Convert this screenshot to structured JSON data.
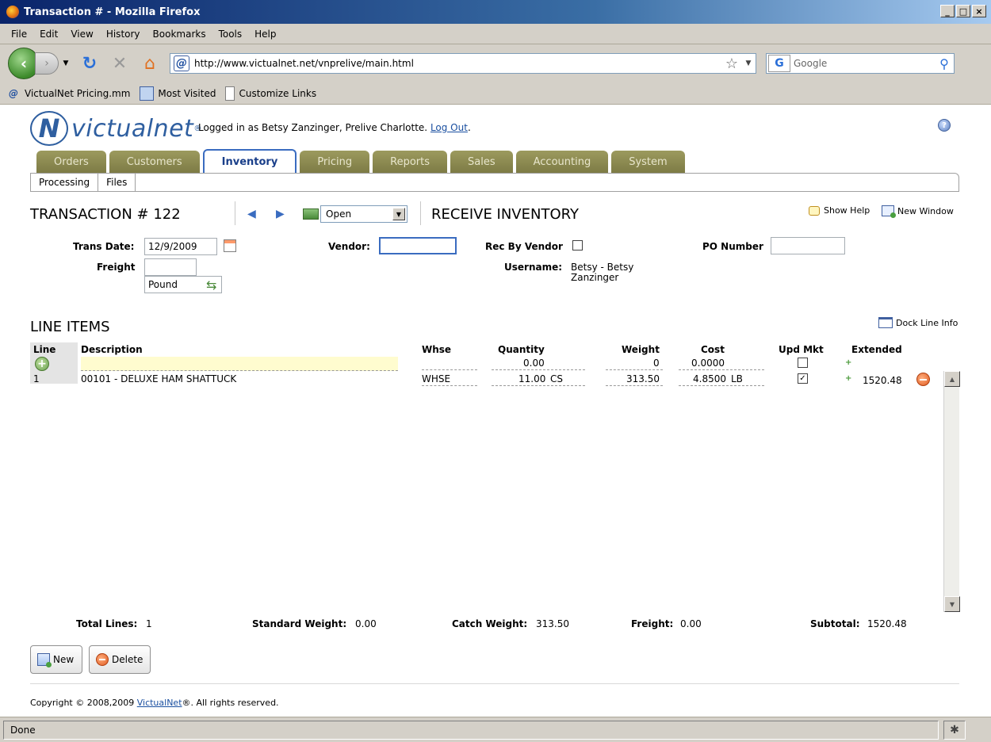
{
  "window": {
    "title": "Transaction #  - Mozilla Firefox",
    "minimize": "_",
    "maximize": "□",
    "close": "×"
  },
  "menu": [
    "File",
    "Edit",
    "View",
    "History",
    "Bookmarks",
    "Tools",
    "Help"
  ],
  "browser": {
    "url": "http://www.victualnet.net/vnprelive/main.html",
    "search_placeholder": "Google",
    "bookmarks": [
      "VictualNet Pricing.mm",
      "Most Visited",
      "Customize Links"
    ]
  },
  "header": {
    "logo_text": "victualnet",
    "logo_mark": "N",
    "logo_reg": "®",
    "logged_in_text": "Logged in as Betsy Zanzinger, Prelive Charlotte.",
    "logout_label": "Log Out",
    "logout_suffix": "."
  },
  "tabs": [
    {
      "label": "Orders",
      "active": false
    },
    {
      "label": "Customers",
      "active": false
    },
    {
      "label": "Inventory",
      "active": true
    },
    {
      "label": "Pricing",
      "active": false
    },
    {
      "label": "Reports",
      "active": false
    },
    {
      "label": "Sales",
      "active": false
    },
    {
      "label": "Accounting",
      "active": false
    },
    {
      "label": "System",
      "active": false
    }
  ],
  "subnav": [
    "Processing",
    "Files"
  ],
  "transaction": {
    "title": "TRANSACTION # 122",
    "status": "Open",
    "page_title": "RECEIVE INVENTORY",
    "show_help": "Show Help",
    "new_window": "New Window"
  },
  "form": {
    "trans_date_label": "Trans Date:",
    "trans_date": "12/9/2009",
    "freight_label": "Freight",
    "freight_value": "",
    "freight_unit": "Pound",
    "vendor_label": "Vendor:",
    "vendor_value": "",
    "rec_by_vendor_label": "Rec By Vendor",
    "rec_by_vendor_checked": false,
    "username_label": "Username:",
    "username_line1": "Betsy - Betsy",
    "username_line2": "Zanzinger",
    "po_number_label": "PO Number",
    "po_number_value": ""
  },
  "line_items": {
    "title": "LINE ITEMS",
    "dock_label": "Dock Line Info",
    "columns": [
      "Line",
      "Description",
      "Whse",
      "Quantity",
      "Weight",
      "Cost",
      "Upd Mkt",
      "Extended"
    ],
    "new_row": {
      "quantity": "0.00",
      "weight": "0",
      "cost": "0.0000"
    },
    "rows": [
      {
        "line": "1",
        "description": "00101 - DELUXE HAM SHATTUCK",
        "whse": "WHSE",
        "quantity": "11.00",
        "qty_unit": "CS",
        "weight": "313.50",
        "cost": "4.8500",
        "cost_unit": "LB",
        "upd_mkt": true,
        "extended": "1520.48"
      }
    ]
  },
  "totals": {
    "total_lines_label": "Total Lines:",
    "total_lines": "1",
    "std_weight_label": "Standard Weight:",
    "std_weight": "0.00",
    "catch_weight_label": "Catch Weight:",
    "catch_weight": "313.50",
    "freight_label": "Freight:",
    "freight": "0.00",
    "subtotal_label": "Subtotal:",
    "subtotal": "1520.48"
  },
  "buttons": {
    "new": "New",
    "delete": "Delete"
  },
  "footer": {
    "copyright_prefix": "Copyright © 2008,2009",
    "copyright_link": "VictualNet",
    "copyright_suffix": "®. All rights reserved."
  },
  "status_bar": "Done"
}
